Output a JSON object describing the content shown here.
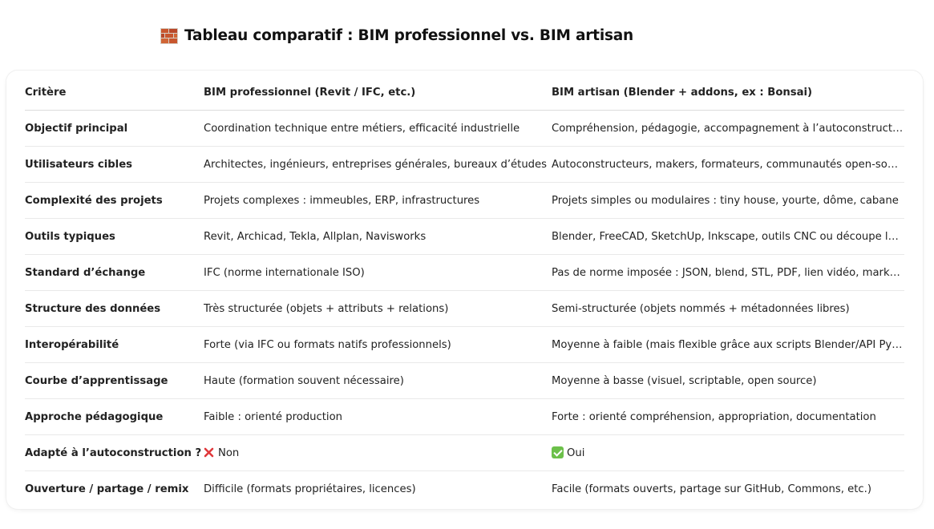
{
  "heading": {
    "icon": "brick-icon",
    "title": "Tableau comparatif : BIM professionnel vs. BIM artisan"
  },
  "table": {
    "headers": {
      "criterion": "Critère",
      "pro": "BIM professionnel (Revit / IFC, etc.)",
      "artisan": "BIM artisan (Blender + addons, ex : Bonsai)"
    },
    "rows": [
      {
        "criterion": "Objectif principal",
        "pro": "Coordination technique entre métiers, efficacité industrielle",
        "artisan": "Compréhension, pédagogie, accompagnement à l’autoconstruction"
      },
      {
        "criterion": "Utilisateurs cibles",
        "pro": "Architectes, ingénieurs, entreprises générales, bureaux d’études",
        "artisan": "Autoconstructeurs, makers, formateurs, communautés open-source"
      },
      {
        "criterion": "Complexité des projets",
        "pro": "Projets complexes : immeubles, ERP, infrastructures",
        "artisan": "Projets simples ou modulaires : tiny house, yourte, dôme, cabane"
      },
      {
        "criterion": "Outils typiques",
        "pro": "Revit, Archicad, Tekla, Allplan, Navisworks",
        "artisan": "Blender, FreeCAD, SketchUp, Inkscape, outils CNC ou découpe laser"
      },
      {
        "criterion": "Standard d’échange",
        "pro": "IFC (norme internationale ISO)",
        "artisan": "Pas de norme imposée : JSON, blend, STL, PDF, lien vidéo, markdown…"
      },
      {
        "criterion": "Structure des données",
        "pro": "Très structurée (objets + attributs + relations)",
        "artisan": "Semi-structurée (objets nommés + métadonnées libres)"
      },
      {
        "criterion": "Interopérabilité",
        "pro": "Forte (via IFC ou formats natifs professionnels)",
        "artisan": "Moyenne à faible (mais flexible grâce aux scripts Blender/API Python)"
      },
      {
        "criterion": "Courbe d’apprentissage",
        "pro": "Haute (formation souvent nécessaire)",
        "artisan": "Moyenne à basse (visuel, scriptable, open source)"
      },
      {
        "criterion": "Approche pédagogique",
        "pro": "Faible : orienté production",
        "artisan": "Forte : orienté compréhension, appropriation, documentation"
      },
      {
        "criterion": "Adapté à l’autoconstruction ?",
        "pro": "Non",
        "pro_icon": "cross-mark-icon",
        "artisan": "Oui",
        "artisan_icon": "check-mark-icon"
      },
      {
        "criterion": "Ouverture / partage / remix",
        "pro": "Difficile (formats propriétaires, licences)",
        "artisan": "Facile (formats ouverts, partage sur GitHub, Commons, etc.)"
      }
    ]
  },
  "colors": {
    "cross": "#e0383b",
    "check": "#6cc04a",
    "brick": "#c8562e"
  }
}
